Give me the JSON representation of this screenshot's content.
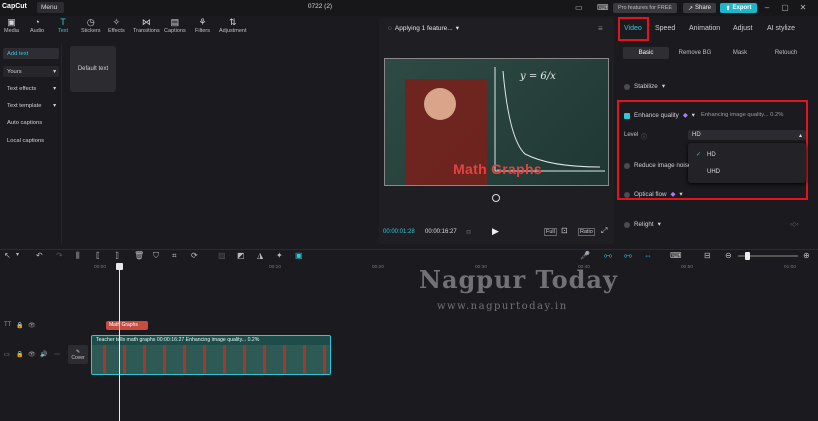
{
  "app": {
    "name": "CapCut",
    "menu_label": "Menu",
    "project_title": "0722 (2)"
  },
  "header": {
    "pro_label": "Pro features for FREE",
    "share_label": "Share",
    "export_label": "Export"
  },
  "toolbar": {
    "items": [
      {
        "label": "Media",
        "icon": "media-icon"
      },
      {
        "label": "Audio",
        "icon": "audio-icon"
      },
      {
        "label": "Text",
        "icon": "text-icon"
      },
      {
        "label": "Stickers",
        "icon": "stickers-icon"
      },
      {
        "label": "Effects",
        "icon": "effects-icon"
      },
      {
        "label": "Transitions",
        "icon": "transitions-icon"
      },
      {
        "label": "Captions",
        "icon": "captions-icon"
      },
      {
        "label": "Filters",
        "icon": "filters-icon"
      },
      {
        "label": "Adjustment",
        "icon": "adjustment-icon"
      }
    ],
    "active": "Text"
  },
  "left_panel": {
    "items": [
      "Add text",
      "Yours",
      "Text effects",
      "Text template",
      "Auto captions",
      "Local captions"
    ],
    "preset_label": "Default text"
  },
  "player": {
    "status": "Applying 1 feature...",
    "overlay_text": "Math Graphs",
    "board_formula": "y = 6/x",
    "current_time": "00:00:01:28",
    "total_time": "00:00:16:27",
    "full_label": "Full",
    "ratio_label": "Ratio"
  },
  "right_panel": {
    "tabs": [
      "Video",
      "Speed",
      "Animation",
      "Adjust",
      "AI stylize"
    ],
    "active_tab": "Video",
    "subtabs": [
      "Basic",
      "Remove BG",
      "Mask",
      "Retouch"
    ],
    "active_subtab": "Basic",
    "stabilize_label": "Stabilize",
    "enhance_label": "Enhance quality",
    "enhance_status": "Enhancing image quality... 0.2%",
    "level_label": "Level",
    "level_value": "HD",
    "level_options": [
      "HD",
      "UHD"
    ],
    "reduce_noise_label": "Reduce image noise",
    "optical_flow_label": "Optical flow",
    "relight_label": "Relight"
  },
  "timeline": {
    "ruler_ticks": [
      "00:00",
      "00:10",
      "00:20",
      "00:30",
      "00:40",
      "00:50",
      "01:00",
      "01:10"
    ],
    "text_clip_label": "Math Graphs",
    "video_clip_label": "Teacher tells math graphs   00:00:16:27   Enhancing image quality... 0.2%",
    "cover_label": "Cover"
  },
  "watermark": {
    "title": "Nagpur Today",
    "url": "www.nagpurtoday.in"
  },
  "colors": {
    "accent": "#2fc6da",
    "highlight_box": "#e0161d",
    "text_clip": "#c74b3f"
  }
}
